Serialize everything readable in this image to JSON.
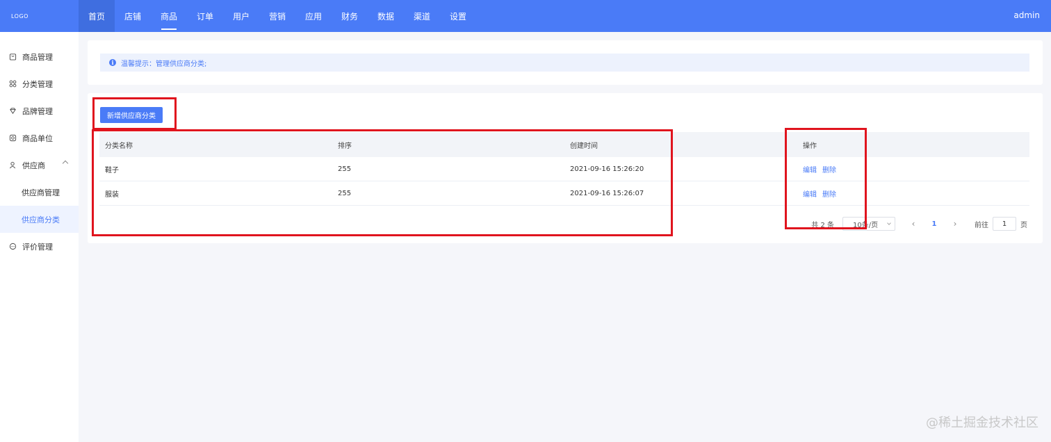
{
  "header": {
    "logo": "LOGO",
    "nav": [
      "首页",
      "店铺",
      "商品",
      "订单",
      "用户",
      "营销",
      "应用",
      "财务",
      "数据",
      "渠道",
      "设置"
    ],
    "user": "admin"
  },
  "sidebar": {
    "items": [
      {
        "label": "商品管理",
        "icon": "bag-icon"
      },
      {
        "label": "分类管理",
        "icon": "grid-icon"
      },
      {
        "label": "品牌管理",
        "icon": "diamond-icon"
      },
      {
        "label": "商品单位",
        "icon": "unit-icon"
      },
      {
        "label": "供应商",
        "icon": "user-icon"
      }
    ],
    "sub_items": [
      "供应商管理",
      "供应商分类"
    ],
    "last_item": {
      "label": "评价管理",
      "icon": "comment-icon"
    }
  },
  "tip": {
    "icon": "i",
    "text": "温馨提示：管理供应商分类;"
  },
  "actions": {
    "add_label": "新增供应商分类"
  },
  "table": {
    "headers": [
      "分类名称",
      "排序",
      "创建时间",
      "操作"
    ],
    "rows": [
      {
        "name": "鞋子",
        "sort": "255",
        "time": "2021-09-16 15:26:20"
      },
      {
        "name": "服装",
        "sort": "255",
        "time": "2021-09-16 15:26:07"
      }
    ],
    "edit_label": "编辑",
    "delete_label": "删除"
  },
  "pagination": {
    "total": "共 2 条",
    "page_size": "10条/页",
    "current_page": "1",
    "goto_label": "前往",
    "goto_value": "1",
    "page_suffix": "页"
  },
  "watermark": "@稀土掘金技术社区",
  "colors": {
    "primary": "#4a7bf7",
    "highlight_box": "#e0141e"
  }
}
